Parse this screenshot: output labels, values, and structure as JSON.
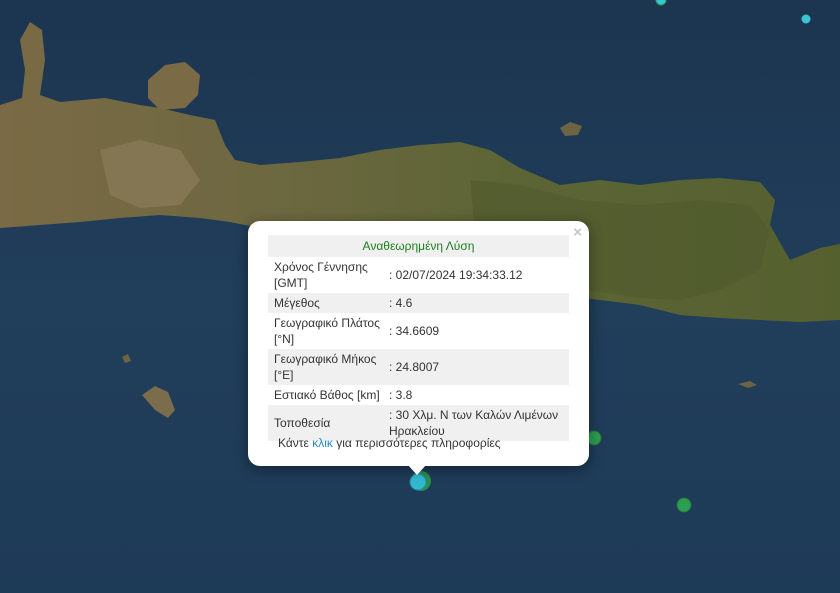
{
  "map": {
    "colors": {
      "sea": "#1f3a55",
      "land": "#6b6a3e",
      "forest": "#4e5e2a",
      "marker_selected": "#33b9cf",
      "marker_other": "#2d9d4f",
      "marker_cyan": "#37c5d6"
    },
    "markers": [
      {
        "name": "selected-earthquake-marker",
        "color": "#33b9cf"
      },
      {
        "name": "earthquake-marker-green-1",
        "color": "#2d9d4f"
      },
      {
        "name": "earthquake-marker-green-2",
        "color": "#2d9d4f"
      },
      {
        "name": "earthquake-marker-cyan-1",
        "color": "#37c5d6"
      },
      {
        "name": "earthquake-marker-cyan-2",
        "color": "#37c5d6"
      }
    ]
  },
  "popup": {
    "close_icon": "×",
    "title": "Αναθεωρημένη Λύση",
    "rows": [
      {
        "label": "Χρόνος Γέννησης [GMT]",
        "value": ": 02/07/2024 19:34:33.12"
      },
      {
        "label": "Μέγεθος",
        "value": ": 4.6"
      },
      {
        "label": "Γεωγραφικό Πλάτος [°N]",
        "value": ": 34.6609"
      },
      {
        "label": "Γεωγραφικό Μήκος [°E]",
        "value": ": 24.8007"
      },
      {
        "label": "Εστιακό Βάθος [km]",
        "value": ": 3.8"
      },
      {
        "label": "Τοποθεσία",
        "value": ": 30 Χλμ. Ν των Καλών Λιμένων Ηρακλείου"
      }
    ],
    "more_prefix": "Κάντε ",
    "more_link": "κλικ",
    "more_suffix": " για περισσότερες πληροφορίες"
  }
}
